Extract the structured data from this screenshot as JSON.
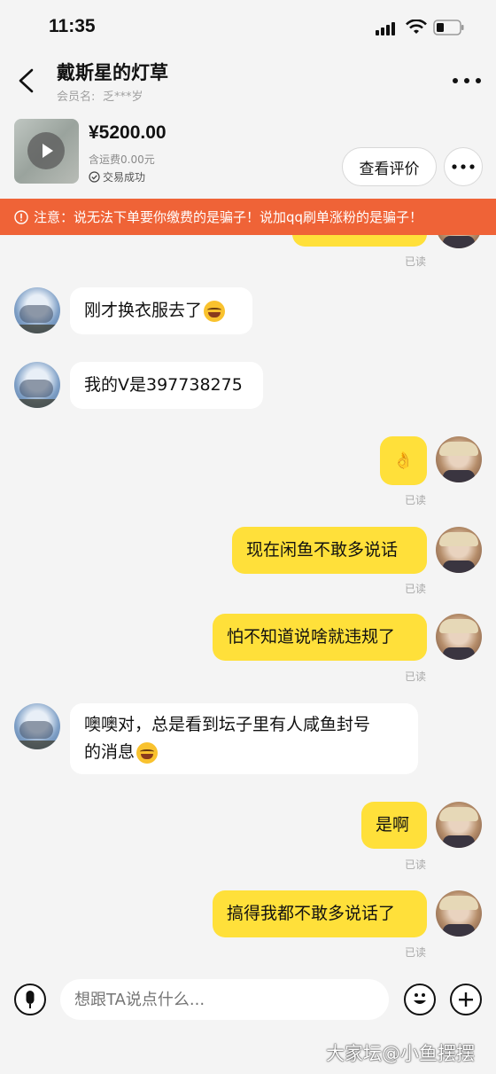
{
  "status_bar": {
    "time": "11:35"
  },
  "header": {
    "title": "戴斯星的灯草",
    "member_label": "会员名:",
    "member_name": "乏***岁"
  },
  "product": {
    "price": "¥5200.00",
    "shipping": "含运费0.00元",
    "trade_status": "交易成功",
    "review_button": "查看评价"
  },
  "warning": {
    "text": "注意：说无法下单要你缴费的是骗子！说加qq刷单涨粉的是骗子！"
  },
  "chat": {
    "read_label": "已读",
    "messages": [
      {
        "from": "other",
        "text": "刚才换衣服去了"
      },
      {
        "from": "other",
        "text": "我的V是397738275"
      },
      {
        "from": "me",
        "text": "👌"
      },
      {
        "from": "me",
        "text": "现在闲鱼不敢多说话"
      },
      {
        "from": "me",
        "text": "怕不知道说啥就违规了"
      },
      {
        "from": "other",
        "text_line1": "噢噢对，总是看到坛子里有人咸鱼封号",
        "text_line2": "的消息"
      },
      {
        "from": "me",
        "text": "是啊"
      },
      {
        "from": "me",
        "text": "搞得我都不敢多说话了"
      }
    ]
  },
  "composer": {
    "placeholder": "想跟TA说点什么..."
  },
  "watermark": "大家坛@小鱼摆摆",
  "colors": {
    "accent_yellow": "#ffe03a",
    "warning_orange": "#ef6337"
  },
  "icons": [
    "signal-icon",
    "wifi-icon",
    "battery-icon",
    "back-icon",
    "more-icon",
    "play-icon",
    "check-circle-icon",
    "alert-icon",
    "mic-icon",
    "emoji-icon",
    "plus-icon"
  ]
}
